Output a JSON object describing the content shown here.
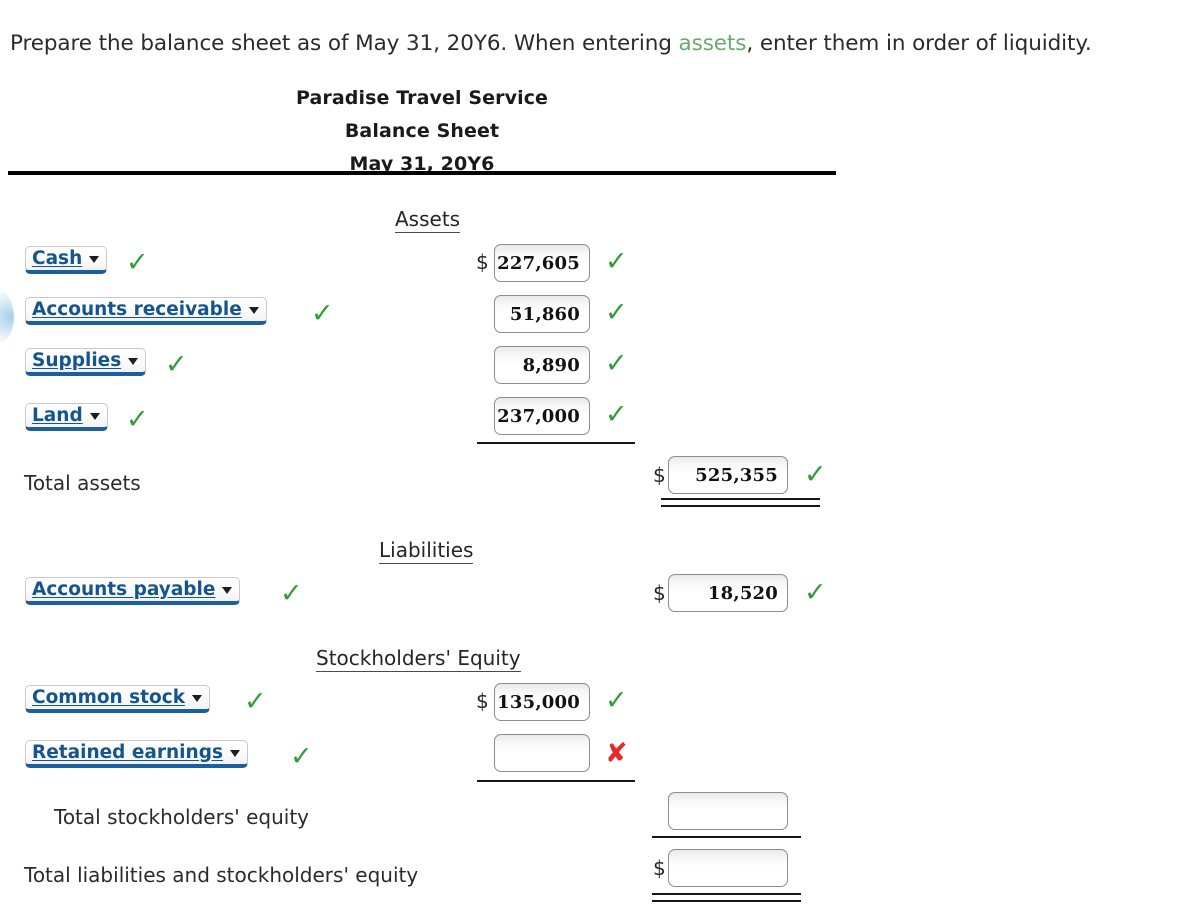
{
  "instruction": {
    "before": "Prepare the balance sheet as of May 31, 20Y6. When entering ",
    "highlight": "assets",
    "after": ", enter them in order of liquidity.",
    "highlight_color": "#6aa96f"
  },
  "statement_header": {
    "company": "Paradise Travel Service",
    "title": "Balance Sheet",
    "date": "May 31, 20Y6"
  },
  "sections": {
    "assets": "Assets",
    "liabilities": "Liabilities",
    "equity": "Stockholders' Equity"
  },
  "marks": {
    "correct": "✓",
    "incorrect": "✘"
  },
  "currency_symbol": "$",
  "rows": [
    {
      "id": "cash",
      "account": "Cash",
      "amount": "227,605",
      "amount_column": 1,
      "dollar": true,
      "account_status": "correct",
      "amount_status": "correct"
    },
    {
      "id": "accounts-receivable",
      "account": "Accounts receivable",
      "amount": "51,860",
      "amount_column": 1,
      "dollar": false,
      "account_status": "correct",
      "amount_status": "correct"
    },
    {
      "id": "supplies",
      "account": "Supplies",
      "amount": "8,890",
      "amount_column": 1,
      "dollar": false,
      "account_status": "correct",
      "amount_status": "correct"
    },
    {
      "id": "land",
      "account": "Land",
      "amount": "237,000",
      "amount_column": 1,
      "dollar": false,
      "account_status": "correct",
      "amount_status": "correct"
    },
    {
      "id": "total-assets",
      "label": "Total assets",
      "amount": "525,355",
      "amount_column": 2,
      "dollar": true,
      "amount_status": "correct"
    },
    {
      "id": "accounts-payable",
      "account": "Accounts payable",
      "amount": "18,520",
      "amount_column": 2,
      "dollar": true,
      "account_status": "correct",
      "amount_status": "correct"
    },
    {
      "id": "common-stock",
      "account": "Common stock",
      "amount": "135,000",
      "amount_column": 1,
      "dollar": true,
      "account_status": "correct",
      "amount_status": "correct"
    },
    {
      "id": "retained-earnings",
      "account": "Retained earnings",
      "amount": "",
      "amount_column": 1,
      "dollar": false,
      "account_status": "correct",
      "amount_status": "incorrect"
    },
    {
      "id": "total-stockholders-equity",
      "label": "Total stockholders' equity",
      "amount": "",
      "amount_column": 2,
      "dollar": false
    },
    {
      "id": "total-liabilities-and-equity",
      "label": "Total liabilities and stockholders' equity",
      "amount": "",
      "amount_column": 2,
      "dollar": true
    }
  ]
}
